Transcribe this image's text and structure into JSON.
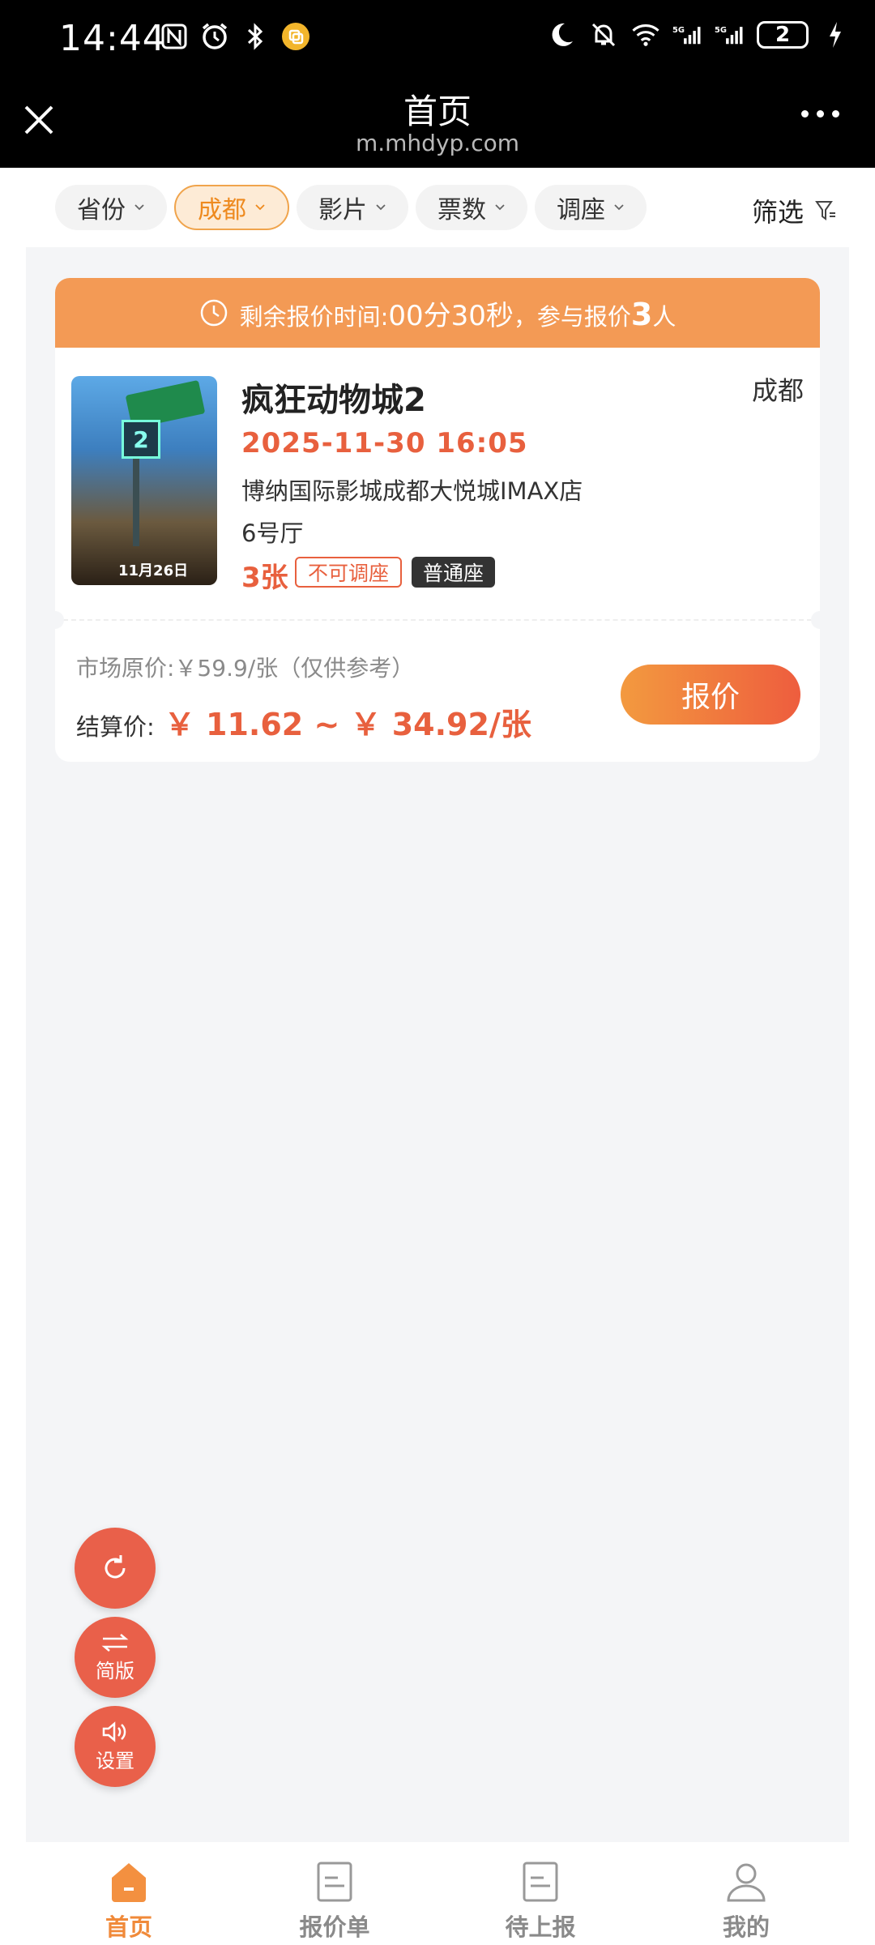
{
  "status_bar": {
    "time": "14:44",
    "battery": "2"
  },
  "title_bar": {
    "title": "首页",
    "url": "m.mhdyp.com"
  },
  "filters": [
    {
      "label": "省份",
      "active": false
    },
    {
      "label": "成都",
      "active": true
    },
    {
      "label": "影片",
      "active": false
    },
    {
      "label": "票数",
      "active": false
    },
    {
      "label": "调座",
      "active": false
    }
  ],
  "filter_button": "筛选",
  "card": {
    "countdown_prefix": "剩余报价时间:",
    "countdown_value": "00分30秒",
    "participants_prefix": "，参与报价",
    "participants_count": "3",
    "participants_suffix": "人",
    "movie_title": "疯狂动物城2",
    "city": "成都",
    "show_time": "2025-11-30 16:05",
    "cinema": "博纳国际影城成都大悦城IMAX店",
    "hall": "6号厅",
    "quantity": "3张",
    "tag_seat_change": "不可调座",
    "tag_seat_type": "普通座",
    "poster_date": "11月26日",
    "market_price": "市场原价:￥59.9/张（仅供参考）",
    "settle_label": "结算价:",
    "settle_price": "￥ 11.62 ~ ￥ 34.92/张",
    "quote_button": "报价"
  },
  "fabs": {
    "refresh": "",
    "simple": "简版",
    "settings": "设置"
  },
  "bottom_nav": [
    {
      "label": "首页",
      "active": true
    },
    {
      "label": "报价单",
      "active": false
    },
    {
      "label": "待上报",
      "active": false
    },
    {
      "label": "我的",
      "active": false
    }
  ],
  "colors": {
    "accent": "#e8603e",
    "orange": "#f39a55",
    "active_chip": "#ee8a1f"
  }
}
